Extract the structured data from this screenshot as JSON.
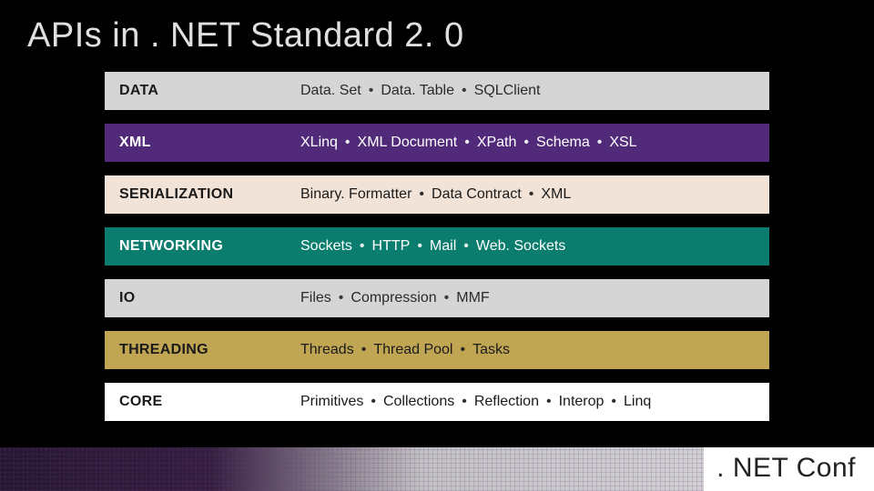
{
  "title": "APIs in . NET Standard 2. 0",
  "footer": ". NET Conf",
  "rows": [
    {
      "label": "DATA",
      "items": [
        "Data. Set",
        "Data. Table",
        "SQLClient"
      ],
      "bg": "#d5d5d5",
      "labelColor": "#1a1a1a",
      "itemsColor": "#2a2a2a"
    },
    {
      "label": "XML",
      "items": [
        "XLinq",
        "XML Document",
        "XPath",
        "Schema",
        "XSL"
      ],
      "bg": "#512b7a",
      "labelColor": "#ffffff",
      "itemsColor": "#ffffff"
    },
    {
      "label": "SERIALIZATION",
      "items": [
        "Binary. Formatter",
        "Data Contract",
        "XML"
      ],
      "bg": "#f2e3d8",
      "labelColor": "#1a1a1a",
      "itemsColor": "#1a1a1a"
    },
    {
      "label": "NETWORKING",
      "items": [
        "Sockets",
        "HTTP",
        "Mail",
        "Web. Sockets"
      ],
      "bg": "#0a7d6f",
      "labelColor": "#ffffff",
      "itemsColor": "#ffffff"
    },
    {
      "label": "IO",
      "items": [
        "Files",
        "Compression",
        "MMF"
      ],
      "bg": "#d5d5d5",
      "labelColor": "#1a1a1a",
      "itemsColor": "#2a2a2a"
    },
    {
      "label": "THREADING",
      "items": [
        "Threads",
        "Thread Pool",
        "Tasks"
      ],
      "bg": "#c0a653",
      "labelColor": "#1a1a1a",
      "itemsColor": "#1a1a1a"
    },
    {
      "label": "CORE",
      "items": [
        "Primitives",
        "Collections",
        "Reflection",
        "Interop",
        "Linq"
      ],
      "bg": "#ffffff",
      "labelColor": "#1a1a1a",
      "itemsColor": "#1a1a1a"
    }
  ]
}
